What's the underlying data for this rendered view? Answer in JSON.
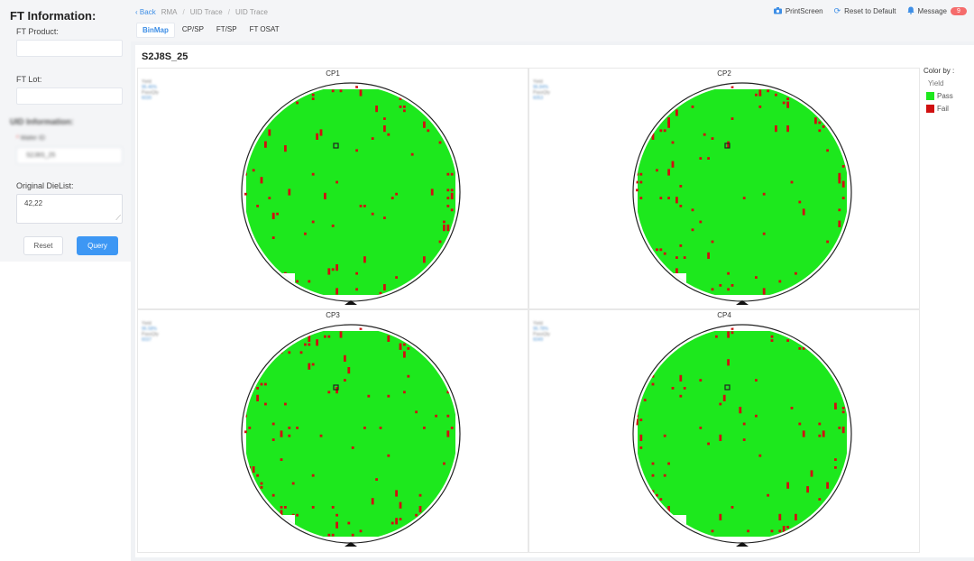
{
  "left_panel": {
    "title": "FT Information:",
    "ft_product_label": "FT Product:",
    "ft_product_value": "",
    "ft_lot_label": "FT Lot:",
    "ft_lot_value": "",
    "uid_section_label": "UID Information:",
    "uid_field_label": "Wafer ID",
    "uid_field_value": "S2J8S_25",
    "die_list_label": "Original DieList:",
    "die_list_value": "42,22",
    "reset_label": "Reset",
    "query_label": "Query"
  },
  "breadcrumb": {
    "back_label": "Back",
    "items": [
      "RMA",
      "UID Trace",
      "UID Trace"
    ]
  },
  "toolbar": {
    "printscreen_label": "PrintScreen",
    "reset_default_label": "Reset to Default",
    "message_label": "Message",
    "message_count": "9"
  },
  "tabs": [
    {
      "label": "BinMap",
      "active": true
    },
    {
      "label": "CP/SP",
      "active": false
    },
    {
      "label": "FT/SP",
      "active": false
    },
    {
      "label": "FT OSAT",
      "active": false
    }
  ],
  "page_title": "S2J8S_25",
  "wafers": [
    {
      "title": "CP1",
      "yield_label": "Yield",
      "yield_value": "96.46%",
      "passqty_label": "PassQty",
      "passqty_value": "6030"
    },
    {
      "title": "CP2",
      "yield_label": "Yield",
      "yield_value": "96.84%",
      "passqty_label": "PassQty",
      "passqty_value": "6053"
    },
    {
      "title": "CP3",
      "yield_label": "Yield",
      "yield_value": "96.58%",
      "passqty_label": "PassQty",
      "passqty_value": "6037"
    },
    {
      "title": "CP4",
      "yield_label": "Yield",
      "yield_value": "96.78%",
      "passqty_label": "PassQty",
      "passqty_value": "6049"
    }
  ],
  "legend": {
    "title": "Color by :",
    "subtitle": "Yield",
    "items": [
      {
        "label": "Pass",
        "color": "#1de81d"
      },
      {
        "label": "Fail",
        "color": "#d01010"
      }
    ]
  },
  "colors": {
    "accent": "#3d97f4",
    "pass": "#1de81d",
    "fail": "#d01010",
    "badge": "#f56c6c"
  }
}
